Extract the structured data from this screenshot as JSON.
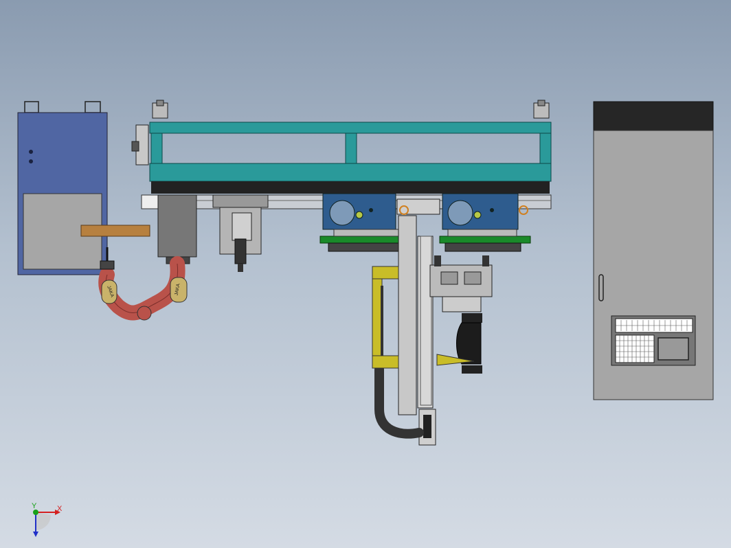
{
  "viewport": {
    "background_top": "#8a9bb0",
    "background_bottom": "#d4dbe4"
  },
  "robot": {
    "brand_label_upper": "JAKA",
    "brand_label_lower": "JAKA",
    "arm_color": "#b9524a",
    "joint_color": "#c9b36a"
  },
  "gantry": {
    "frame_color": "#2a9a9a",
    "deck_color": "#222222"
  },
  "control_cabinet": {
    "body_color": "#a6a6a6",
    "top_color": "#262626"
  },
  "power_cabinet": {
    "body_color": "#5066a3"
  },
  "triad": {
    "x_label": "X",
    "y_label": "Y",
    "x_color": "#d42020",
    "y_color": "#18a018",
    "z_color": "#2030c8"
  }
}
